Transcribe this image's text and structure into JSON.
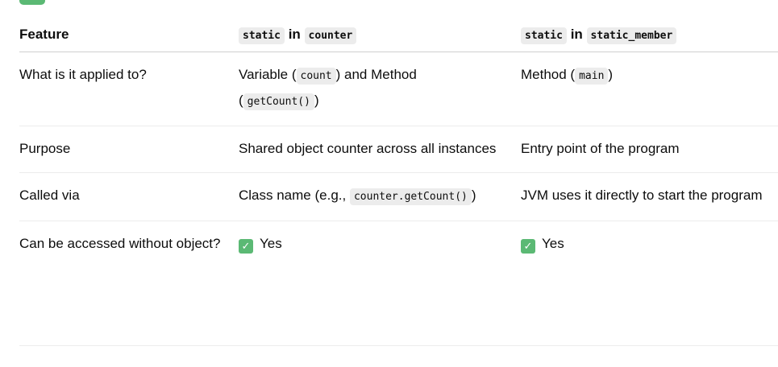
{
  "header": {
    "feature": "Feature",
    "col2": {
      "code_a": "static",
      "word": "in",
      "code_b": "counter"
    },
    "col3": {
      "code_a": "static",
      "word": "in",
      "code_b": "static_member"
    }
  },
  "rows": [
    {
      "feature": "What is it applied to?",
      "col2": {
        "t1": "Variable (",
        "code1": "count",
        "t2": ") and Method",
        "t3": "(",
        "code2": "getCount()",
        "t4": ")"
      },
      "col3": {
        "t1": "Method (",
        "code1": "main",
        "t2": ")"
      }
    },
    {
      "feature": "Purpose",
      "col2": {
        "t1": "Shared object counter across all instances"
      },
      "col3": {
        "t1": "Entry point of the program"
      }
    },
    {
      "feature": "Called via",
      "col2": {
        "t1": "Class name (e.g.,",
        "code1": "counter.getCount()",
        "t2": ")"
      },
      "col3": {
        "t1": "JVM uses it directly to start the program"
      }
    },
    {
      "feature": "Can be accessed without object?",
      "col2": {
        "check_icon": "check-mark-icon",
        "t1": "Yes"
      },
      "col3": {
        "check_icon": "check-mark-icon",
        "t1": "Yes"
      }
    }
  ],
  "colors": {
    "check_green": "#5bb974",
    "code_bg": "#ececec"
  }
}
